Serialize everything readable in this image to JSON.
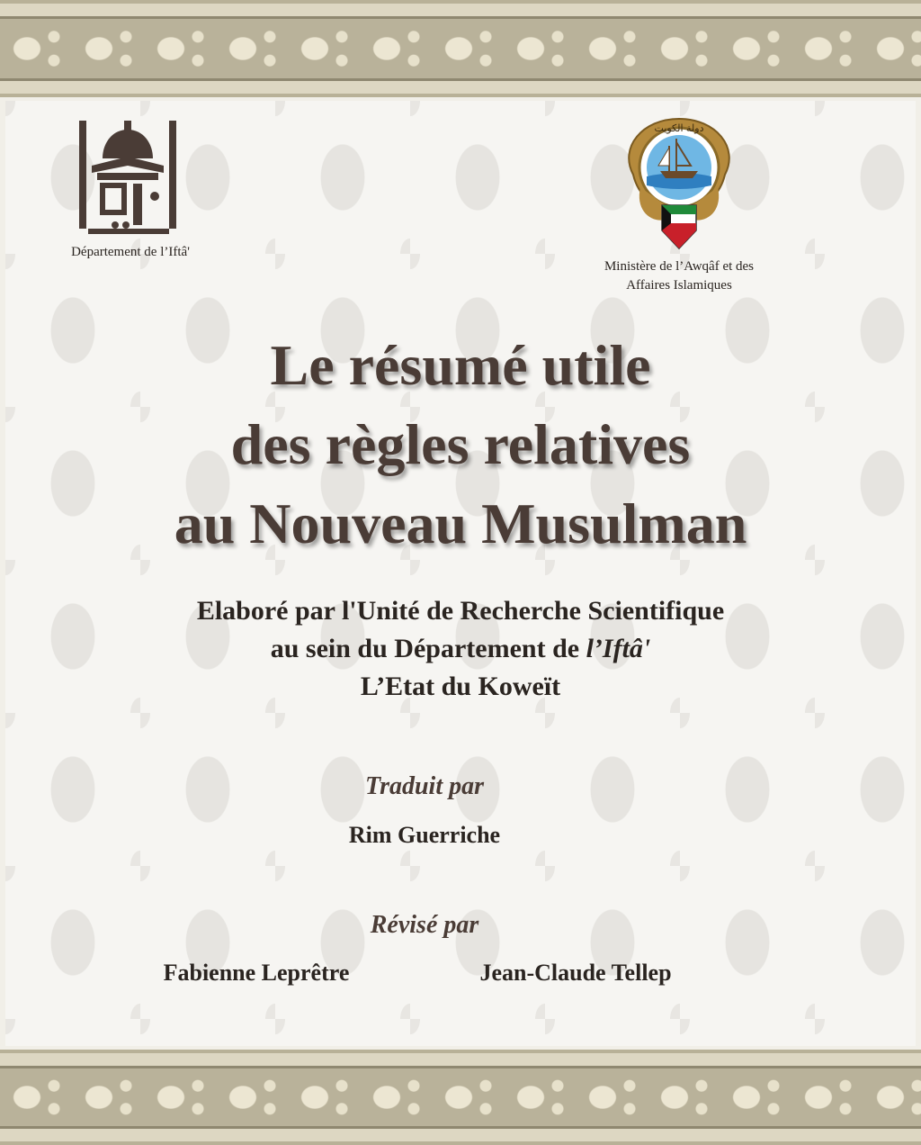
{
  "header_left": {
    "caption": "Département de l’Iftâ'"
  },
  "header_right": {
    "caption_line1": "Ministère de l’Awqâf et des",
    "caption_line2": "Affaires Islamiques",
    "emblem_script": "دولة الكويت"
  },
  "title": {
    "line1": "Le résumé utile",
    "line2": "des règles relatives",
    "line3": "au Nouveau Musulman"
  },
  "subtitle": {
    "line1": "Elaboré par l'Unité de Recherche Scientifique",
    "line2_prefix": "au sein du Département de ",
    "line2_italic": "l’Iftâ'",
    "line3": "L’Etat du Koweït"
  },
  "translation": {
    "label": "Traduit par",
    "name": "Rim Guerriche"
  },
  "revision": {
    "label": "Révisé par",
    "names": [
      "Fabienne Leprêtre",
      "Jean-Claude Tellep"
    ]
  },
  "colors": {
    "title": "#4a3c36",
    "text": "#2a2420",
    "border": "#b9b29a",
    "flag_green": "#1f8a3a",
    "flag_red": "#c8202a"
  }
}
